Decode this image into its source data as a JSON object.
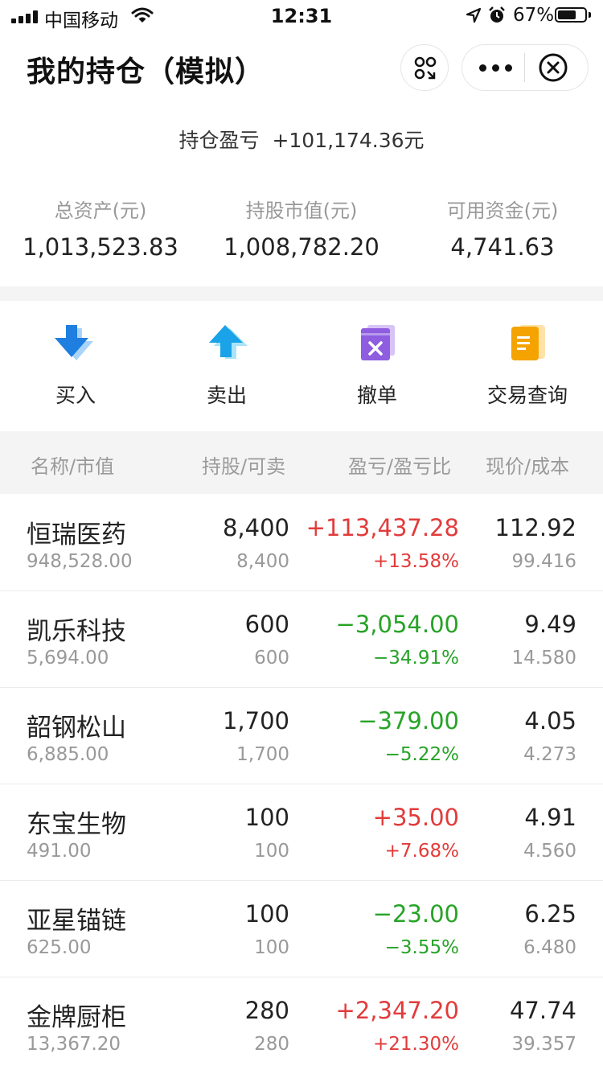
{
  "status_bar": {
    "carrier": "中国移动",
    "time": "12:31",
    "battery": "67%"
  },
  "nav": {
    "title": "我的持仓（模拟）"
  },
  "summary": {
    "pl_label": "持仓盈亏",
    "pl_value": "+101,174.36元",
    "metrics": [
      {
        "label": "总资产(元)",
        "value": "1,013,523.83"
      },
      {
        "label": "持股市值(元)",
        "value": "1,008,782.20"
      },
      {
        "label": "可用资金(元)",
        "value": "4,741.63"
      }
    ]
  },
  "actions": [
    {
      "label": "买入",
      "icon": "buy-arrow-down-icon"
    },
    {
      "label": "卖出",
      "icon": "sell-arrow-up-icon"
    },
    {
      "label": "撤单",
      "icon": "cancel-order-icon"
    },
    {
      "label": "交易查询",
      "icon": "trade-query-document-icon"
    }
  ],
  "table": {
    "headers": [
      "名称/市值",
      "持股/可卖",
      "盈亏/盈亏比",
      "现价/成本"
    ],
    "rows": [
      {
        "name": "恒瑞医药",
        "market_value": "948,528.00",
        "holding": "8,400",
        "available": "8,400",
        "pl": "+113,437.28",
        "pl_ratio": "+13.58%",
        "price": "112.92",
        "cost": "99.416",
        "trend": "up"
      },
      {
        "name": "凯乐科技",
        "market_value": "5,694.00",
        "holding": "600",
        "available": "600",
        "pl": "−3,054.00",
        "pl_ratio": "−34.91%",
        "price": "9.49",
        "cost": "14.580",
        "trend": "down"
      },
      {
        "name": "韶钢松山",
        "market_value": "6,885.00",
        "holding": "1,700",
        "available": "1,700",
        "pl": "−379.00",
        "pl_ratio": "−5.22%",
        "price": "4.05",
        "cost": "4.273",
        "trend": "down"
      },
      {
        "name": "东宝生物",
        "market_value": "491.00",
        "holding": "100",
        "available": "100",
        "pl": "+35.00",
        "pl_ratio": "+7.68%",
        "price": "4.91",
        "cost": "4.560",
        "trend": "up"
      },
      {
        "name": "亚星锚链",
        "market_value": "625.00",
        "holding": "100",
        "available": "100",
        "pl": "−23.00",
        "pl_ratio": "−3.55%",
        "price": "6.25",
        "cost": "6.480",
        "trend": "down"
      },
      {
        "name": "金牌厨柜",
        "market_value": "13,367.20",
        "holding": "280",
        "available": "280",
        "pl": "+2,347.20",
        "pl_ratio": "+21.30%",
        "price": "47.74",
        "cost": "39.357",
        "trend": "up"
      }
    ]
  },
  "colors": {
    "up": "#e23b3b",
    "down": "#27a327",
    "buy_icon": "#1e7fe0",
    "sell_icon": "#1aa3e8",
    "cancel_icon": "#8e5de0",
    "query_icon": "#f4a300"
  }
}
